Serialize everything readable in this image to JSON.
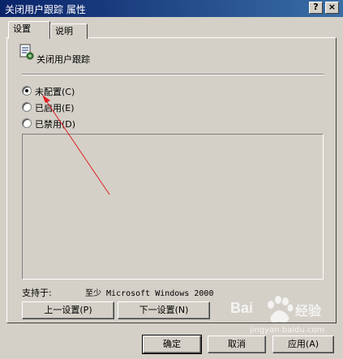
{
  "window": {
    "title": "关闭用户跟踪 属性"
  },
  "titlebar": {
    "help_label": "?",
    "close_label": "×"
  },
  "tabs": [
    {
      "label": "设置",
      "active": true
    },
    {
      "label": "说明",
      "active": false
    }
  ],
  "setting": {
    "name": "关闭用户跟踪",
    "icon": "policy-setting-icon"
  },
  "options": [
    {
      "label": "未配置(C)",
      "checked": true
    },
    {
      "label": "已启用(E)",
      "checked": false
    },
    {
      "label": "已禁用(D)",
      "checked": false
    }
  ],
  "supported": {
    "label": "支持于:",
    "value": "至少 Microsoft Windows 2000"
  },
  "nav_buttons": {
    "prev": "上一设置(P)",
    "next": "下一设置(N)"
  },
  "dialog_buttons": {
    "ok": "确定",
    "cancel": "取消",
    "apply": "应用(A)"
  },
  "watermark": {
    "brand_left": "Bai",
    "brand_right": "经验",
    "url": "jingyan.baidu.com"
  },
  "colors": {
    "title_start": "#0a246a",
    "title_end": "#3a6ea5",
    "face": "#d4d0c8",
    "annotation_arrow": "#e02020",
    "watermark": "#ffffff"
  }
}
